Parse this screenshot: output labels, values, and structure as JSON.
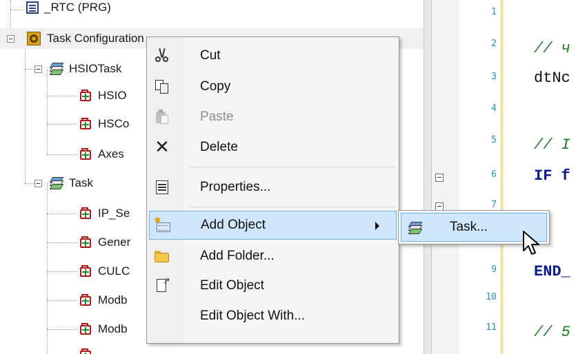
{
  "tree": {
    "nodes": [
      {
        "label": "_RTC (PRG)",
        "icon": "program-icon"
      },
      {
        "label": "Task Configuration",
        "icon": "task-configuration-icon"
      },
      {
        "label": "HSIOTask",
        "icon": "task-icon"
      },
      {
        "label": "HSIO",
        "icon": "pou-call-icon"
      },
      {
        "label": "HSCo",
        "icon": "pou-call-icon"
      },
      {
        "label": "Axes",
        "icon": "pou-call-icon"
      },
      {
        "label": "Task",
        "icon": "task-icon"
      },
      {
        "label": "IP_Se",
        "icon": "pou-call-icon"
      },
      {
        "label": "Gener",
        "icon": "pou-call-icon"
      },
      {
        "label": "CULC",
        "icon": "pou-call-icon"
      },
      {
        "label": "Modb",
        "icon": "pou-call-icon"
      },
      {
        "label": "Modb",
        "icon": "pou-call-icon"
      }
    ]
  },
  "editor": {
    "line_numbers": [
      "1",
      "2",
      "3",
      "4",
      "5",
      "6",
      "7",
      "9",
      "10",
      "11"
    ],
    "code_lines": [
      {
        "text": "// ч",
        "kind": "comment"
      },
      {
        "text": "dtNc",
        "kind": "plain"
      },
      {
        "text": "// I",
        "kind": "comment"
      },
      {
        "text": "IF f",
        "kind": "keyword"
      },
      {
        "text": "END_",
        "kind": "keyword"
      },
      {
        "text": "// 5",
        "kind": "comment"
      }
    ]
  },
  "context_menu": {
    "items": [
      {
        "label": "Cut",
        "icon": "scissors-icon",
        "enabled": true
      },
      {
        "label": "Copy",
        "icon": "copy-icon",
        "enabled": true
      },
      {
        "label": "Paste",
        "icon": "paste-icon",
        "enabled": false
      },
      {
        "label": "Delete",
        "icon": "delete-icon",
        "enabled": true
      },
      {
        "label": "Properties...",
        "icon": "properties-icon",
        "enabled": true
      },
      {
        "label": "Add Object",
        "icon": "add-object-icon",
        "enabled": true,
        "highlighted": true,
        "has_submenu": true
      },
      {
        "label": "Add Folder...",
        "icon": "folder-icon",
        "enabled": true
      },
      {
        "label": "Edit Object",
        "icon": "edit-object-icon",
        "enabled": true
      },
      {
        "label": "Edit Object With...",
        "icon": "",
        "enabled": true
      }
    ]
  },
  "submenu": {
    "items": [
      {
        "label": "Task...",
        "icon": "task-icon",
        "highlighted": true
      }
    ]
  },
  "colors": {
    "highlight_bg": "#cfe6fb",
    "highlight_border": "#6fb3ea",
    "comment": "#1e7a2a",
    "keyword": "#0a1a8a",
    "line_number": "#2b91af"
  }
}
